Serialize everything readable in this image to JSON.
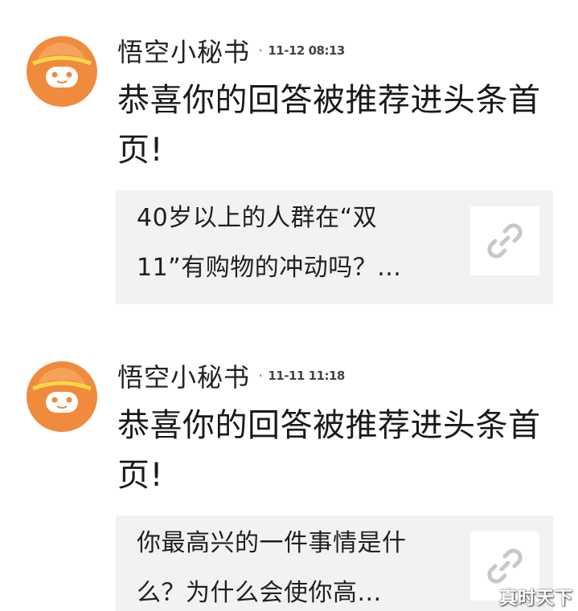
{
  "messages": [
    {
      "sender": "悟空小秘书",
      "separator": "·",
      "time": "11-12 08:13",
      "text": "恭喜你的回答被推荐进头条首页!",
      "card": {
        "title": "40岁以上的人群在“双11”有购物的冲动吗？...",
        "icon": "link-icon"
      }
    },
    {
      "sender": "悟空小秘书",
      "separator": "·",
      "time": "11-11 11:18",
      "text": "恭喜你的回答被推荐进头条首页!",
      "card": {
        "title": "你最高兴的一件事情是什么？为什么会使你高...",
        "icon": "link-icon"
      }
    }
  ],
  "watermark": "真时天下",
  "colors": {
    "avatar_orange": "#f08a3c",
    "card_background": "#f2f2f2",
    "link_icon": "#c8c8c8"
  }
}
